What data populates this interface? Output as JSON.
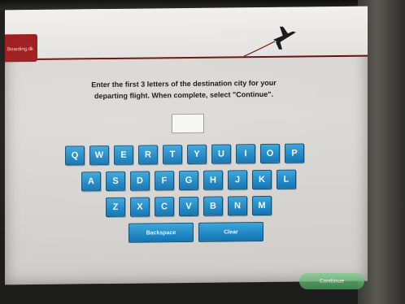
{
  "header": {
    "brand_text": "Boarding.dk"
  },
  "prompt": {
    "line1": "Enter the first 3 letters of the destination city for your",
    "line2": "departing flight. When complete, select \"Continue\"."
  },
  "entry": {
    "value": ""
  },
  "keyboard": {
    "row1": [
      "Q",
      "W",
      "E",
      "R",
      "T",
      "Y",
      "U",
      "I",
      "O",
      "P"
    ],
    "row2": [
      "A",
      "S",
      "D",
      "F",
      "G",
      "H",
      "J",
      "K",
      "L"
    ],
    "row3": [
      "Z",
      "X",
      "C",
      "V",
      "B",
      "N",
      "M"
    ],
    "backspace_label": "Backspace",
    "clear_label": "Clear"
  },
  "footer": {
    "continue_label": "Continue"
  },
  "colors": {
    "key_blue": "#1c86c4",
    "brand_red": "#9e1b1b",
    "continue_green": "#4aa65c"
  }
}
